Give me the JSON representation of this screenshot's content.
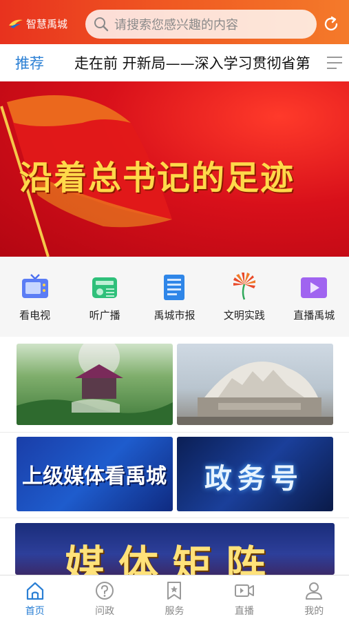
{
  "header": {
    "logo_text": "智慧禹城",
    "search_placeholder": "请搜索您感兴趣的内容"
  },
  "tabbar": {
    "active_tab": "推荐",
    "headline": "走在前 开新局——深入学习贯彻省第"
  },
  "banner": {
    "text": "沿着总书记的足迹"
  },
  "quick_nav": [
    {
      "label": "看电视",
      "icon": "tv-icon"
    },
    {
      "label": "听广播",
      "icon": "radio-icon"
    },
    {
      "label": "禹城市报",
      "icon": "newspaper-icon"
    },
    {
      "label": "文明实践",
      "icon": "civilization-icon"
    },
    {
      "label": "直播禹城",
      "icon": "live-video-icon"
    }
  ],
  "tiles": {
    "media_view": "上级媒体看禹城",
    "gov_account": "政务号",
    "media_matrix": "媒体矩阵"
  },
  "bottom_nav": [
    {
      "label": "首页",
      "icon": "home-icon",
      "active": true
    },
    {
      "label": "问政",
      "icon": "question-icon",
      "active": false
    },
    {
      "label": "服务",
      "icon": "bookmark-icon",
      "active": false
    },
    {
      "label": "直播",
      "icon": "video-camera-icon",
      "active": false
    },
    {
      "label": "我的",
      "icon": "user-icon",
      "active": false
    }
  ],
  "colors": {
    "accent_blue": "#2a7fd4",
    "header_red": "#e8321e",
    "header_orange": "#f47a2a"
  }
}
